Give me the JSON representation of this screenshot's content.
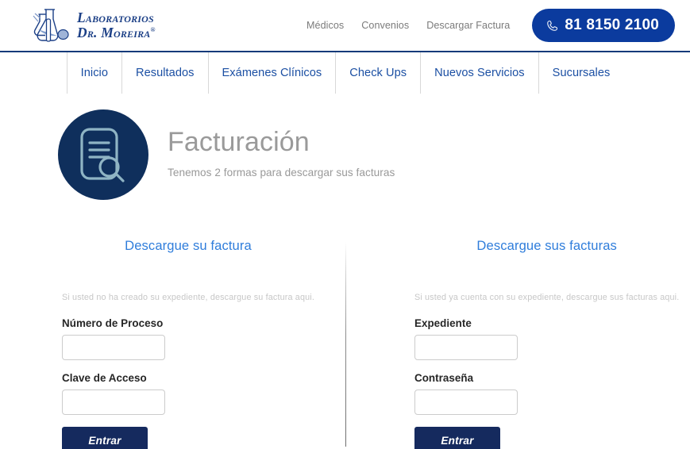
{
  "brand": {
    "logo_line_1": "Laboratorios",
    "logo_line_2": "Dr. Moreira",
    "registered_mark": "®",
    "logo_icon": "lab-glassware-icon",
    "accent_navy": "#123a7a",
    "accent_blue": "#0b3b9e",
    "link_blue": "#1b4fa3",
    "heading_blue": "#2f7ddb",
    "button_navy": "#152a5e",
    "icon_circle_navy": "#0f2f5c"
  },
  "top_header": {
    "links": [
      {
        "label": "Médicos"
      },
      {
        "label": "Convenios"
      },
      {
        "label": "Descargar Factura"
      }
    ],
    "phone": {
      "number": "81 8150 2100",
      "icon": "phone-icon"
    }
  },
  "main_nav": {
    "items": [
      {
        "label": "Inicio"
      },
      {
        "label": "Resultados"
      },
      {
        "label": "Exámenes Clínicos"
      },
      {
        "label": "Check Ups"
      },
      {
        "label": "Nuevos Servicios"
      },
      {
        "label": "Sucursales"
      }
    ]
  },
  "page_header": {
    "icon": "document-search-icon",
    "title": "Facturación",
    "subtitle": "Tenemos 2 formas para descargar sus facturas"
  },
  "forms": {
    "left": {
      "heading": "Descargue su factura",
      "description": "Si usted no ha creado su expediente, descargue su factura aqui.",
      "fields": [
        {
          "label": "Número de Proceso",
          "value": "",
          "placeholder": ""
        },
        {
          "label": "Clave de Acceso",
          "value": "",
          "placeholder": ""
        }
      ],
      "submit_label": "Entrar"
    },
    "right": {
      "heading": "Descargue sus facturas",
      "description": "Si usted ya cuenta con su expediente, descargue sus facturas aqui.",
      "fields": [
        {
          "label": "Expediente",
          "value": "",
          "placeholder": ""
        },
        {
          "label": "Contraseña",
          "value": "",
          "placeholder": ""
        }
      ],
      "submit_label": "Entrar"
    }
  }
}
